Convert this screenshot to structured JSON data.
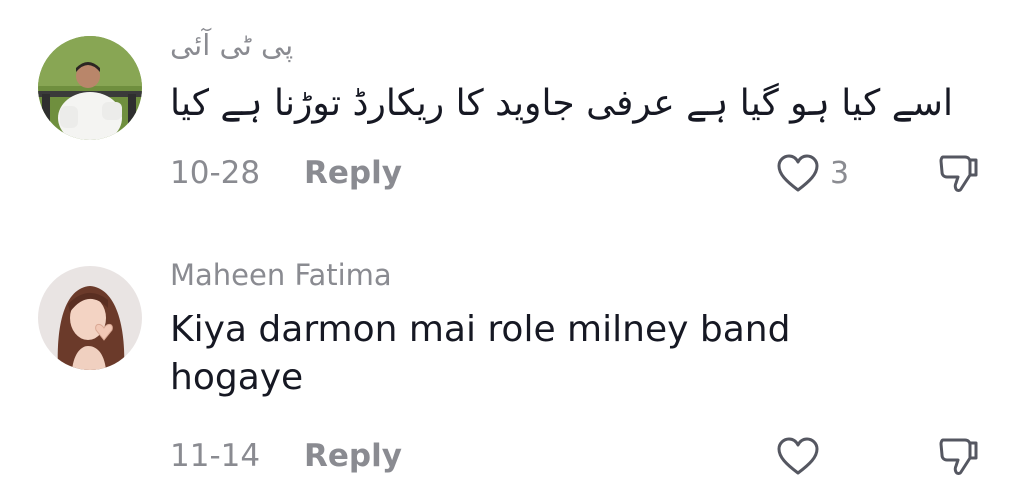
{
  "comments": [
    {
      "username": "پی ٹی آئی",
      "text": "اسے کیا ہو گیا ہے عرفی جاوید کا ریکارڈ توڑنا ہے کیا",
      "date": "10-28",
      "reply_label": "Reply",
      "like_count": "3",
      "avatar_icon": "avatar-photo-man-in-white"
    },
    {
      "username": "Maheen Fatima",
      "text": "Kiya darmon mai role milney band hogaye",
      "date": "11-14",
      "reply_label": "Reply",
      "like_count": "",
      "avatar_icon": "avatar-photo-woman-heart-hands"
    }
  ],
  "icons": {
    "like": "heart-outline-icon",
    "dislike": "thumbs-down-outline-icon"
  },
  "colors": {
    "text_primary": "#161823",
    "text_secondary": "#8a8b91",
    "icon": "#555761"
  }
}
